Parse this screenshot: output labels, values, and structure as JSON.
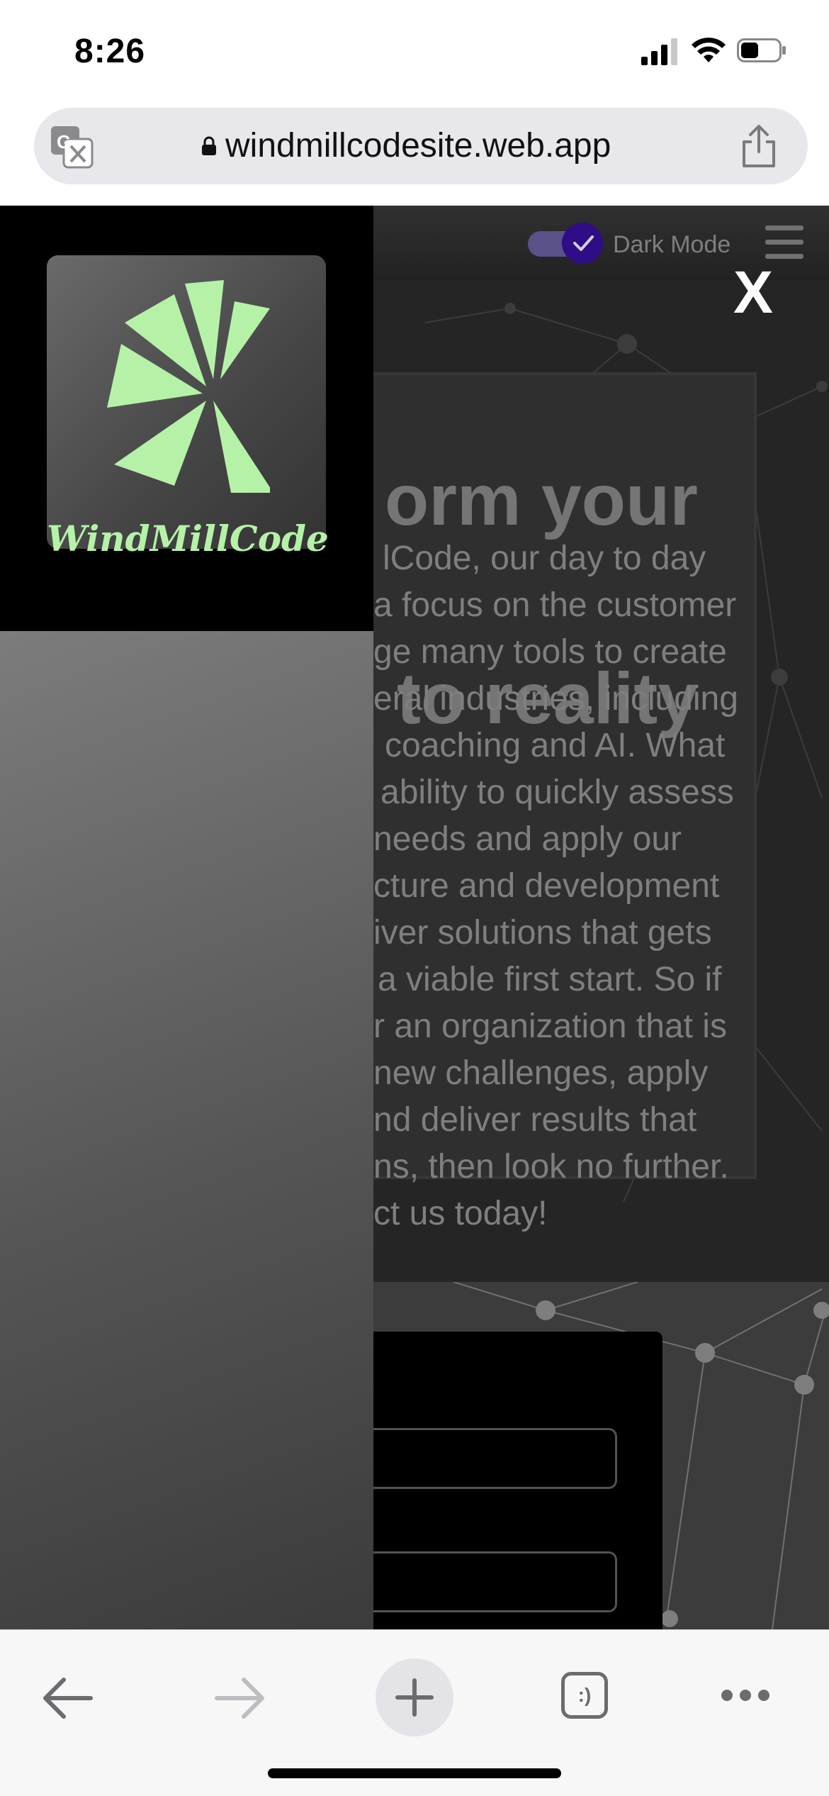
{
  "status_bar": {
    "time": "8:26",
    "icons": [
      "cellular-signal-icon",
      "wifi-icon",
      "battery-icon"
    ]
  },
  "address_bar": {
    "url": "windmillcodesite.web.app",
    "icons": [
      "translate-icon",
      "lock-icon",
      "share-icon"
    ]
  },
  "site_header": {
    "dark_mode_label": "Dark Mode",
    "dark_mode_on": true,
    "menu_icon": "hamburger-icon",
    "accent_color": "#3a10a5"
  },
  "hero": {
    "title_lines": [
      "orm your",
      "to reality"
    ],
    "body_lines": [
      "lCode, our day to day",
      "a focus on the customer",
      "ge many tools to create",
      "eral industries, including",
      "coaching and AI. What",
      "ability to quickly assess",
      "needs and apply our",
      "cture and development",
      "iver solutions that gets",
      "a viable first start. So if",
      "r an organization that is",
      "new challenges, apply",
      "nd deliver results that",
      "ns, then look no further.",
      "ct us today!"
    ]
  },
  "menu": {
    "close_label": "X",
    "logo_text": "WindMillCode",
    "logo_color": "#b5f2a8"
  },
  "toolbar": {
    "icons": [
      "back-arrow-icon",
      "forward-arrow-icon",
      "new-tab-plus-icon",
      "tabs-icon",
      "more-icon"
    ],
    "tabs_label": ":)"
  }
}
